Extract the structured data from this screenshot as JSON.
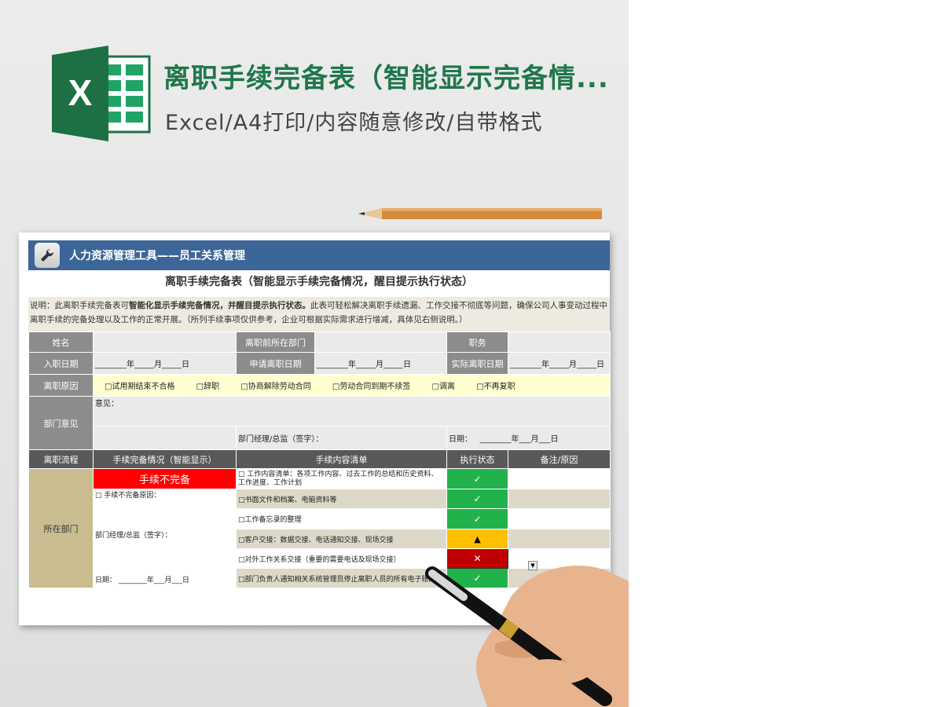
{
  "header": {
    "title": "离职手续完备表（智能显示完备情...",
    "subtitle": "Excel/A4打印/内容随意修改/自带格式",
    "logo_letter": "X"
  },
  "sheet": {
    "banner": "人力资源管理工具——员工关系管理",
    "form_title": "离职手续完备表（智能显示手续完备情况，醒目提示执行状态）",
    "note": {
      "p1": "说明：此离职手续完备表可",
      "b1": "智能化显示手续完备情况，并醒目提示执行状态。",
      "p2": "此表可轻松解决离职手续遗漏、工作交接不彻底等问题，确保公司人事变动过程中离职手续的完备处理以及工作的正常开展。（所列手续事项仅供参考，企业可根据实际需求进行增减，具体见右侧说明。）"
    },
    "info": {
      "name_label": "姓名",
      "dept_label": "离职前所在部门",
      "position_label": "职务",
      "join_label": "入职日期",
      "apply_label": "申请离职日期",
      "actual_label": "实际离职日期",
      "date_blank": "________年_____月_____日",
      "reason_label": "离职原因",
      "reasons": [
        "□试用期结束不合格",
        "□辞职",
        "□协商解除劳动合同",
        "□劳动合同到期不续签",
        "□调离",
        "□不再复职"
      ],
      "opinion_label": "部门意见",
      "opinion_text": "意见：",
      "sign_text": "部门经理/总监（签字）：",
      "date_text": "日期：",
      "date_blank2": "________年___月___日"
    },
    "process": {
      "headers": [
        "离职流程",
        "手续完备情况（智能显示）",
        "手续内容清单",
        "执行状态",
        "备注/原因"
      ],
      "stage": "所在部门",
      "status_text": "手续不完备",
      "reason_text": "□ 手续不完备原因：",
      "sign_text": "部门经理/总监（签字）：",
      "date_text": "日期：  ________年___月___日",
      "items": [
        {
          "text1": "□ 工作内容清单：各项工作内容、过去工作的总结和历史资料、",
          "text2": "工作进度、工作计划",
          "status": "✓"
        },
        {
          "text1": "□书面文件和档案、电脑资料等",
          "status": "✓"
        },
        {
          "text1": "□工作备忘录的整理",
          "status": "✓"
        },
        {
          "text1": "□客户交接：数据交接、电话通知交接、现场交接",
          "status": "▲"
        },
        {
          "text1": "□对外工作关系交接（重要的需要电话及现场交接）",
          "status": "✕"
        },
        {
          "text1": "□部门负责人通知相关系统管理员停止离职人员的所有电子账户",
          "status": "✓"
        }
      ]
    }
  },
  "colors": {
    "brand_green": "#20774a",
    "banner_blue": "#3d6698",
    "ok_green": "#22b24c",
    "warn_yellow": "#ffc000",
    "bad_red": "#c00000",
    "incomplete_red": "#ff0000"
  },
  "icons": {
    "logo": "excel-logo-icon",
    "banner": "wrench-icon",
    "dropdown": "chevron-down-icon"
  }
}
